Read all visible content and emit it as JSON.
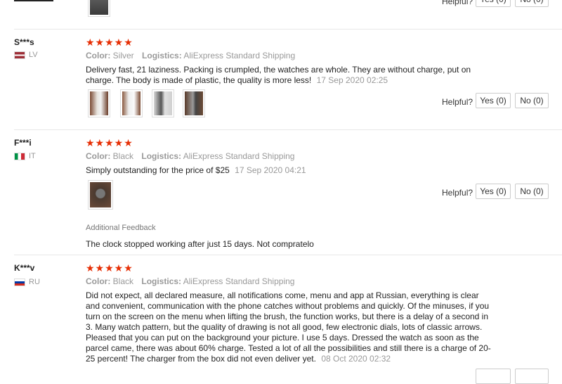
{
  "top": {
    "helpful_label": "Helpful?",
    "yes_label": "Yes (0)",
    "no_label": "No (0)"
  },
  "reviews": [
    {
      "user": "S***s",
      "country": "LV",
      "rating": "★★★★★",
      "color_label": "Color:",
      "color_value": "Silver",
      "logistics_label": "Logistics:",
      "logistics_value": "AliExpress Standard Shipping",
      "text": "Delivery fast, 21 laziness. Packing is crumpled, the watches are whole. They are without charge, put on charge. The body is made of plastic, the quality is more less!",
      "date": "17 Sep 2020 02:25",
      "helpful_label": "Helpful?",
      "yes_label": "Yes (0)",
      "no_label": "No (0)"
    },
    {
      "user": "F***i",
      "country": "IT",
      "rating": "★★★★★",
      "color_label": "Color:",
      "color_value": "Black",
      "logistics_label": "Logistics:",
      "logistics_value": "AliExpress Standard Shipping",
      "text": "Simply outstanding for the price of $25",
      "date": "17 Sep 2020 04:21",
      "helpful_label": "Helpful?",
      "yes_label": "Yes (0)",
      "no_label": "No (0)",
      "additional_label": "Additional Feedback",
      "additional_text": "The clock stopped working after just 15 days. Not compratelo"
    },
    {
      "user": "K***v",
      "country": "RU",
      "rating": "★★★★★",
      "color_label": "Color:",
      "color_value": "Black",
      "logistics_label": "Logistics:",
      "logistics_value": "AliExpress Standard Shipping",
      "text": "Did not expect, all declared measure, all notifications come, menu and app at Russian, everything is clear and convenient, communication with the phone catches without problems and quickly. Of the minuses, if you turn on the screen on the menu when lifting the brush, the function works, but there is a delay of a second in 3. Many watch pattern, but the quality of drawing is not all good, few electronic dials, lots of classic arrows. Pleased that you can put on the background your picture. I use 5 days. Dressed the watch as soon as the parcel came, there was about 60% charge. Tested a lot of all the possibilities and still there is a charge of 20-25 percent! The charger from the box did not even deliver yet.",
      "date": "08 Oct 2020 02:32"
    }
  ]
}
